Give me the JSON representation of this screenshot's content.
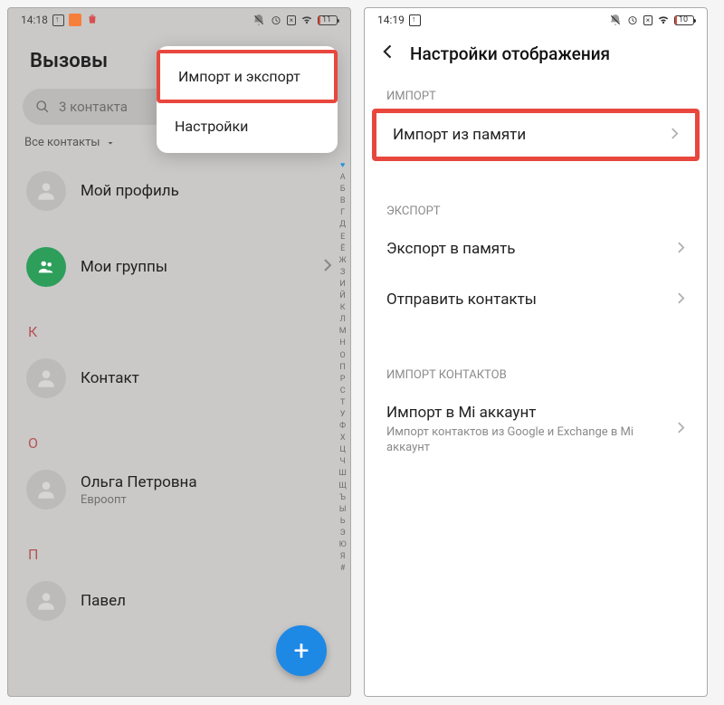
{
  "left": {
    "status": {
      "time": "14:18",
      "battery": "11"
    },
    "title": "Вызовы",
    "searchPlaceholder": "3 контакта",
    "filter": "Все контакты",
    "menu": {
      "importExport": "Импорт и экспорт",
      "settings": "Настройки"
    },
    "items": {
      "profile": "Мой профиль",
      "groups": "Мои группы",
      "k": "К",
      "contact": "Контакт",
      "o": "О",
      "olga": "Ольга Петровна",
      "olgaSub": "Евроопт",
      "p": "П",
      "pavel": "Павел"
    },
    "alphaIndex": [
      "А",
      "Б",
      "В",
      "Г",
      "Д",
      "Е",
      "Ё",
      "Ж",
      "З",
      "И",
      "Й",
      "К",
      "Л",
      "М",
      "Н",
      "О",
      "П",
      "Р",
      "С",
      "Т",
      "У",
      "Ф",
      "Х",
      "Ц",
      "Ч",
      "Ш",
      "Щ",
      "Ъ",
      "Ы",
      "Ь",
      "Э",
      "Ю",
      "Я",
      "#"
    ]
  },
  "right": {
    "status": {
      "time": "14:19",
      "battery": "10"
    },
    "title": "Настройки отображения",
    "sections": {
      "import": "ИМПОРТ",
      "export": "ЭКСПОРТ",
      "importContacts": "ИМПОРТ КОНТАКТОВ"
    },
    "rows": {
      "importMemory": "Импорт из памяти",
      "exportMemory": "Экспорт в память",
      "sendContacts": "Отправить контакты",
      "importMi": "Импорт в Mi аккаунт",
      "importMiSub": "Импорт контактов из Google и Exchange в Mi аккаунт"
    }
  }
}
